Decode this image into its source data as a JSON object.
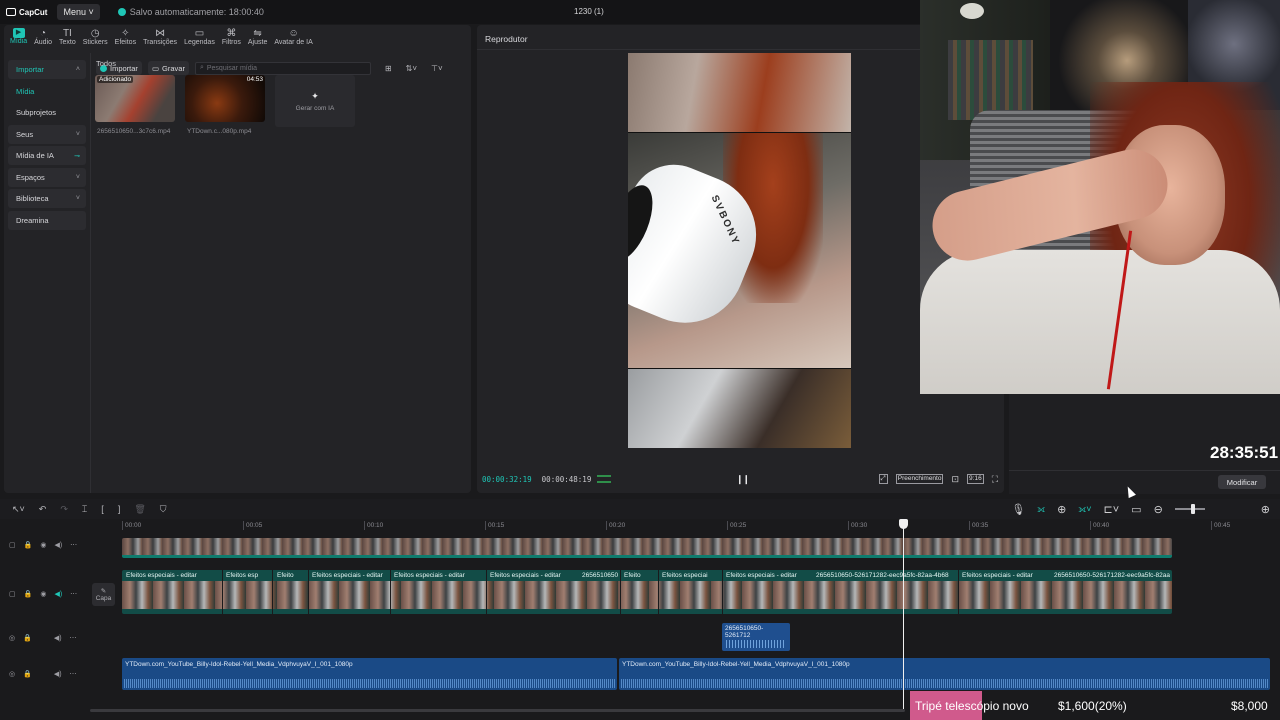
{
  "app": {
    "logo_text": "CapCut",
    "menu_label": "Menu",
    "autosave_text": "Salvo automaticamente: 18:00:40",
    "project_title": "1230 (1)"
  },
  "tool_tabs": [
    {
      "label": "Mídia",
      "icon": "media-icon",
      "active": true
    },
    {
      "label": "Áudio",
      "icon": "audio-icon"
    },
    {
      "label": "Texto",
      "icon": "text-icon"
    },
    {
      "label": "Stickers",
      "icon": "sticker-icon"
    },
    {
      "label": "Efeitos",
      "icon": "effects-icon"
    },
    {
      "label": "Transições",
      "icon": "transitions-icon"
    },
    {
      "label": "Legendas",
      "icon": "captions-icon"
    },
    {
      "label": "Filtros",
      "icon": "filters-icon"
    },
    {
      "label": "Ajuste",
      "icon": "adjust-icon"
    },
    {
      "label": "Avatar de IA",
      "icon": "ai-avatar-icon"
    }
  ],
  "sidebar": {
    "items": [
      {
        "label": "Importar",
        "chevron": "˄"
      },
      {
        "label": "Mídia"
      },
      {
        "label": "Subprojetos"
      },
      {
        "label": "Seus",
        "chevron": "˅"
      },
      {
        "label": "Mídia de IA"
      },
      {
        "label": "Espaços",
        "chevron": "˅"
      },
      {
        "label": "Biblioteca",
        "chevron": "˅"
      },
      {
        "label": "Dreamina"
      }
    ]
  },
  "media_toolbar": {
    "import_label": "Importar",
    "record_label": "Gravar",
    "search_placeholder": "Pesquisar mídia"
  },
  "media": {
    "section_label": "Todos",
    "items": [
      {
        "badge": "Adicionado",
        "duration": "",
        "filename": "2656510650...3c7c6.mp4"
      },
      {
        "badge": "",
        "duration": "04:53",
        "filename": "YTDown.c...080p.mp4"
      }
    ],
    "generate_label": "Gerar com IA"
  },
  "player": {
    "title": "Reprodutor",
    "current_time": "00:00:32:19",
    "total_time": "00:00:48:19",
    "fill_label": "Preenchimento",
    "ratio_label": "9:16",
    "brand_on_device": "SVBONY"
  },
  "right_panel": {
    "clock": "28:35:51",
    "modify_label": "Modificar"
  },
  "timeline": {
    "ruler": [
      "00:00",
      "00:05",
      "00:10",
      "00:15",
      "00:20",
      "00:25",
      "00:30",
      "00:35",
      "00:40",
      "00:45"
    ],
    "cover_label": "Capa",
    "main_segments": [
      "Efeitos especiais - editar",
      "Efeitos esp",
      "Efeito",
      "Efeitos especiais - editar",
      "Efeitos especiais - editar",
      "Efeitos especiais - editar",
      "2656510650",
      "Efeito",
      "Efeitos especiai",
      "Efeitos especiais - editar",
      "2656510650-526171282-eec9a5fc-82aa-4b68",
      "Efeitos especiais - editar",
      "2656510650-526171282-eec9a5fc-82aa"
    ],
    "small_audio_label": "2656510650-5261712",
    "audio_clips": [
      "YTDown.com_YouTube_Billy-Idol-Rebel-Yell_Media_VdphvuyaV_I_001_1080p",
      "YTDown.com_YouTube_Billy-Idol-Rebel-Yell_Media_VdphvuyaV_I_001_1080p"
    ]
  },
  "ticker": {
    "item": "Tripé telescópio novo",
    "price1": "$1,600(20%)",
    "price2": "$8,000"
  },
  "colors": {
    "accent": "#1fc6b6",
    "clip_teal": "#124c47",
    "audio_blue": "#1a4a86",
    "ticker_pink": "#d05a8c"
  }
}
